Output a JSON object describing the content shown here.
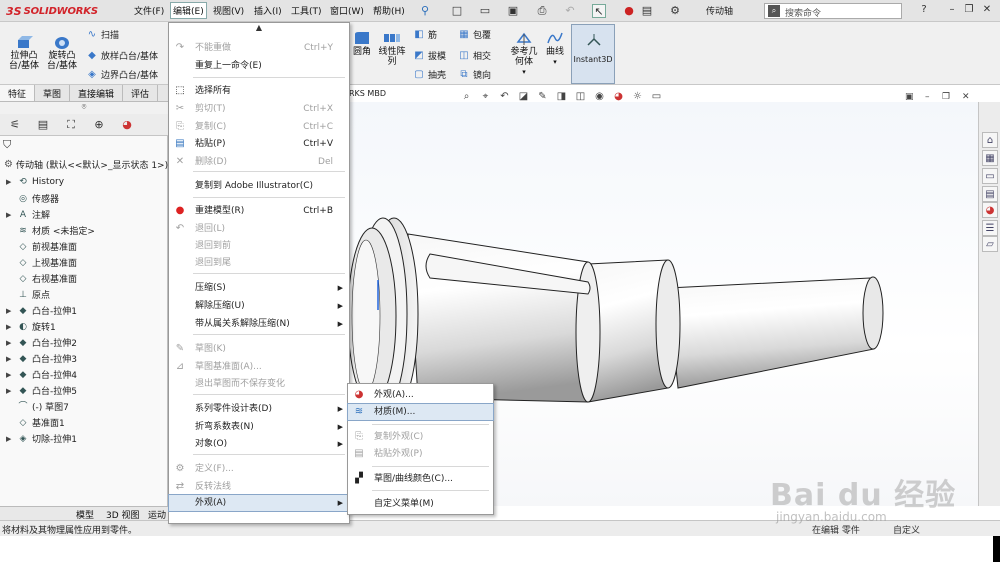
{
  "app": {
    "logo_ds": "3S",
    "logo_text": "SOLIDWORKS",
    "doc_title": "传动轴",
    "search_placeholder": "搜索命令"
  },
  "menubar": {
    "items": [
      "文件(F)",
      "编辑(E)",
      "视图(V)",
      "插入(I)",
      "工具(T)",
      "窗口(W)",
      "帮助(H)"
    ],
    "active": "编辑(E)"
  },
  "ribbon": {
    "extrude_boss": "拉伸凸\n台/基体",
    "revolve_boss": "旋转凸\n台/基体",
    "sweep": "扫描",
    "loft": "放样凸台/基体",
    "boundary": "边界凸台/基体",
    "fillet": "圆角",
    "linear_pattern": "线性阵\n列",
    "rib": "筋",
    "draft": "拔模",
    "shell": "抽壳",
    "wrap": "包覆",
    "intersect": "相交",
    "mirror": "镜向",
    "ref_geometry": "参考几\n何体",
    "curves": "曲线",
    "instant3d": "Instant3D"
  },
  "command_tabs": [
    "特征",
    "草图",
    "直接编辑",
    "评估"
  ],
  "command_tabs_selected": "特征",
  "mbd_label": "RKS MBD",
  "feature_tree": {
    "root": "传动轴 (默认<<默认>_显示状态 1>)",
    "items": [
      {
        "label": "History",
        "icon": "history-icon",
        "expandable": true
      },
      {
        "label": "传感器",
        "icon": "sensor-icon",
        "expandable": false
      },
      {
        "label": "注解",
        "icon": "annotation-icon",
        "expandable": true
      },
      {
        "label": "材质 <未指定>",
        "icon": "material-icon",
        "expandable": false
      },
      {
        "label": "前视基准面",
        "icon": "plane-icon",
        "expandable": false
      },
      {
        "label": "上视基准面",
        "icon": "plane-icon",
        "expandable": false
      },
      {
        "label": "右视基准面",
        "icon": "plane-icon",
        "expandable": false
      },
      {
        "label": "原点",
        "icon": "origin-icon",
        "expandable": false
      },
      {
        "label": "凸台-拉伸1",
        "icon": "extrude-icon",
        "expandable": true
      },
      {
        "label": "旋转1",
        "icon": "revolve-icon",
        "expandable": true
      },
      {
        "label": "凸台-拉伸2",
        "icon": "extrude-icon",
        "expandable": true
      },
      {
        "label": "凸台-拉伸3",
        "icon": "extrude-icon",
        "expandable": true
      },
      {
        "label": "凸台-拉伸4",
        "icon": "extrude-icon",
        "expandable": true
      },
      {
        "label": "凸台-拉伸5",
        "icon": "extrude-icon",
        "expandable": true
      },
      {
        "label": "(-) 草图7",
        "icon": "sketch-icon",
        "expandable": false
      },
      {
        "label": "基准面1",
        "icon": "plane-icon",
        "expandable": false
      },
      {
        "label": "切除-拉伸1",
        "icon": "cut-icon",
        "expandable": true
      }
    ]
  },
  "edit_menu": {
    "items": [
      {
        "label": "不能重做",
        "shortcut": "Ctrl+Y",
        "disabled": true,
        "icon": "redo-icon"
      },
      {
        "label": "重复上一命令(E)",
        "shortcut": "",
        "disabled": false,
        "icon": ""
      },
      {
        "label": "选择所有",
        "shortcut": "",
        "disabled": false,
        "icon": "select-all-icon"
      },
      {
        "label": "剪切(T)",
        "shortcut": "Ctrl+X",
        "disabled": true,
        "icon": "cut-scissors-icon"
      },
      {
        "label": "复制(C)",
        "shortcut": "Ctrl+C",
        "disabled": true,
        "icon": "copy-icon"
      },
      {
        "label": "粘贴(P)",
        "shortcut": "Ctrl+V",
        "disabled": false,
        "icon": "paste-icon"
      },
      {
        "label": "删除(D)",
        "shortcut": "Del",
        "disabled": true,
        "icon": "delete-icon"
      },
      {
        "label": "复制到 Adobe Illustrator(C)",
        "shortcut": "",
        "disabled": false,
        "icon": ""
      },
      {
        "label": "重建模型(R)",
        "shortcut": "Ctrl+B",
        "disabled": false,
        "icon": "rebuild-icon"
      },
      {
        "label": "退回(L)",
        "shortcut": "",
        "disabled": true,
        "icon": "rollback-icon"
      },
      {
        "label": "退回到前",
        "shortcut": "",
        "disabled": true,
        "icon": ""
      },
      {
        "label": "退回到尾",
        "shortcut": "",
        "disabled": true,
        "icon": ""
      },
      {
        "label": "压缩(S)",
        "shortcut": "",
        "disabled": false,
        "icon": "",
        "submenu": true
      },
      {
        "label": "解除压缩(U)",
        "shortcut": "",
        "disabled": false,
        "icon": "",
        "submenu": true
      },
      {
        "label": "带从属关系解除压缩(N)",
        "shortcut": "",
        "disabled": false,
        "icon": "",
        "submenu": true
      },
      {
        "label": "草图(K)",
        "shortcut": "",
        "disabled": true,
        "icon": "sketch-edit-icon"
      },
      {
        "label": "草图基准面(A)...",
        "shortcut": "",
        "disabled": true,
        "icon": "sketch-plane-icon"
      },
      {
        "label": "退出草图而不保存变化",
        "shortcut": "",
        "disabled": true,
        "icon": ""
      },
      {
        "label": "系列零件设计表(D)",
        "shortcut": "",
        "disabled": false,
        "icon": "",
        "submenu": true
      },
      {
        "label": "折弯系数表(N)",
        "shortcut": "",
        "disabled": false,
        "icon": "",
        "submenu": true
      },
      {
        "label": "对象(O)",
        "shortcut": "",
        "disabled": false,
        "icon": "",
        "submenu": true
      },
      {
        "label": "定义(F)...",
        "shortcut": "",
        "disabled": true,
        "icon": "define-icon"
      },
      {
        "label": "反转法线",
        "shortcut": "",
        "disabled": true,
        "icon": "flip-normal-icon"
      },
      {
        "label": "外观(A)",
        "shortcut": "",
        "disabled": false,
        "icon": "",
        "submenu": true,
        "highlighted": true
      }
    ]
  },
  "appearance_submenu": {
    "items": [
      {
        "label": "外观(A)...",
        "disabled": false,
        "icon": "appearance-ball-icon"
      },
      {
        "label": "材质(M)...",
        "disabled": false,
        "icon": "material-menu-icon",
        "highlighted": true
      },
      {
        "label": "复制外观(C)",
        "disabled": true,
        "icon": "copy-appearance-icon"
      },
      {
        "label": "粘贴外观(P)",
        "disabled": true,
        "icon": "paste-appearance-icon"
      },
      {
        "label": "草图/曲线颜色(C)...",
        "disabled": false,
        "icon": "sketch-color-icon"
      },
      {
        "label": "自定义菜单(M)",
        "disabled": false,
        "icon": ""
      }
    ]
  },
  "bottom_tabs": [
    "模型",
    "3D 视图",
    "运动"
  ],
  "bottom_tabs_selected": "模型",
  "status": {
    "message": "将材料及其物理属性应用到零件。",
    "right1": "在编辑 零件",
    "right2": "自定义"
  },
  "watermark": {
    "text": "Bai du 经验",
    "sub": "jingyan.baidu.com"
  },
  "colors": {
    "accent": "#d2232a",
    "menu_highlight": "#dde8f3",
    "ribbon_bg": "#f0f0f0"
  }
}
